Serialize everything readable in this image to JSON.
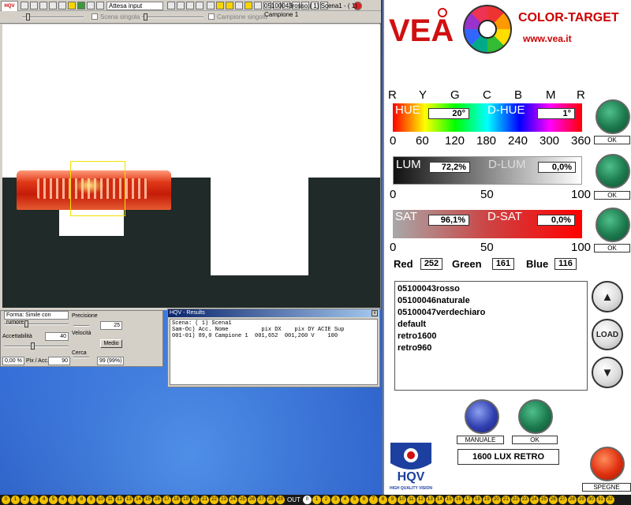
{
  "camera_window": {
    "toolbar": {
      "input_state": "Attesa input",
      "single_scene_label": "Scena singola",
      "single_sample_label": "Campione singolo",
      "window_title": "05100043rosso.( 1) Scena1 - ( 1) Campione 1"
    },
    "logo_text": "HQV"
  },
  "tools_panel": {
    "shape_select": "Forma: Simile con rumore",
    "precision_label": "Precisione",
    "precision_value": "25",
    "acceptability_label": "Accettabilità",
    "acceptability_value": "40",
    "speed_label": "Velocità",
    "speed_value": "Medio",
    "search_label": "Cerca",
    "percent_value": "0,00 %",
    "pix_acc_label": "Pix / Acc.",
    "pix_acc_value": "90",
    "confidence_value": "99 (99%)"
  },
  "results_window": {
    "title": "HQV - Results",
    "close_glyph": "x",
    "lines": [
      "Scena: ( 1) Scena1",
      "Sam-Oc) Acc. Nome          pix DX    pix DY ACIE Sup",
      "001-01) 89,0 Campione 1  001,652  001,260 V    100"
    ]
  },
  "color_panel": {
    "brand": "VEA",
    "title": "COLOR-TARGET",
    "url": "www.vea.it",
    "hue_scale_letters": [
      "R",
      "Y",
      "G",
      "C",
      "B",
      "M",
      "R"
    ],
    "hue_scale_numbers": [
      "0",
      "60",
      "120",
      "180",
      "240",
      "300",
      "360"
    ],
    "hue": {
      "label": "HUE",
      "value": "20°",
      "delta_label": "D-HUE",
      "delta_value": "1°"
    },
    "lum": {
      "label": "LUM",
      "value": "72,2%",
      "delta_label": "D-LUM",
      "delta_value": "0,0%"
    },
    "lum_scale": [
      "0",
      "50",
      "100"
    ],
    "sat": {
      "label": "SAT",
      "value": "96,1%",
      "delta_label": "D-SAT",
      "delta_value": "0,0%"
    },
    "sat_scale": [
      "0",
      "50",
      "100"
    ],
    "ok_label": "OK",
    "rgb": {
      "red_label": "Red",
      "red_value": "252",
      "green_label": "Green",
      "green_value": "161",
      "blue_label": "Blue",
      "blue_value": "116"
    },
    "programs": [
      "05100043rosso",
      "05100046naturale",
      "05100047verdechiaro",
      "default",
      "retro1600",
      "retro960"
    ],
    "load_label": "LOAD",
    "up_glyph": "▲",
    "down_glyph": "▼",
    "manuale_label": "MANUALE",
    "ok2_label": "OK",
    "preset_value": "1600 LUX RETRO",
    "spegne_label": "SPEGNE",
    "hqv_brand": "HQV",
    "hqv_tagline": "HIGH QUALITY VISION"
  },
  "status_strip": {
    "inputs": [
      "0",
      "1",
      "2",
      "3",
      "4",
      "5",
      "6",
      "7",
      "8",
      "9",
      "10",
      "11",
      "12",
      "13",
      "14",
      "15",
      "16",
      "17",
      "18",
      "19",
      "20",
      "21",
      "22",
      "23",
      "24",
      "25",
      "26",
      "27",
      "28",
      "29"
    ],
    "out_label": "OUT",
    "outputs": [
      "0",
      "1",
      "2",
      "3",
      "4",
      "5",
      "6",
      "7",
      "8",
      "9",
      "10",
      "11",
      "12",
      "13",
      "14",
      "15",
      "16",
      "17",
      "18",
      "19",
      "20",
      "21",
      "22",
      "23",
      "24",
      "25",
      "26",
      "27",
      "28",
      "29",
      "30",
      "31",
      "32"
    ]
  }
}
